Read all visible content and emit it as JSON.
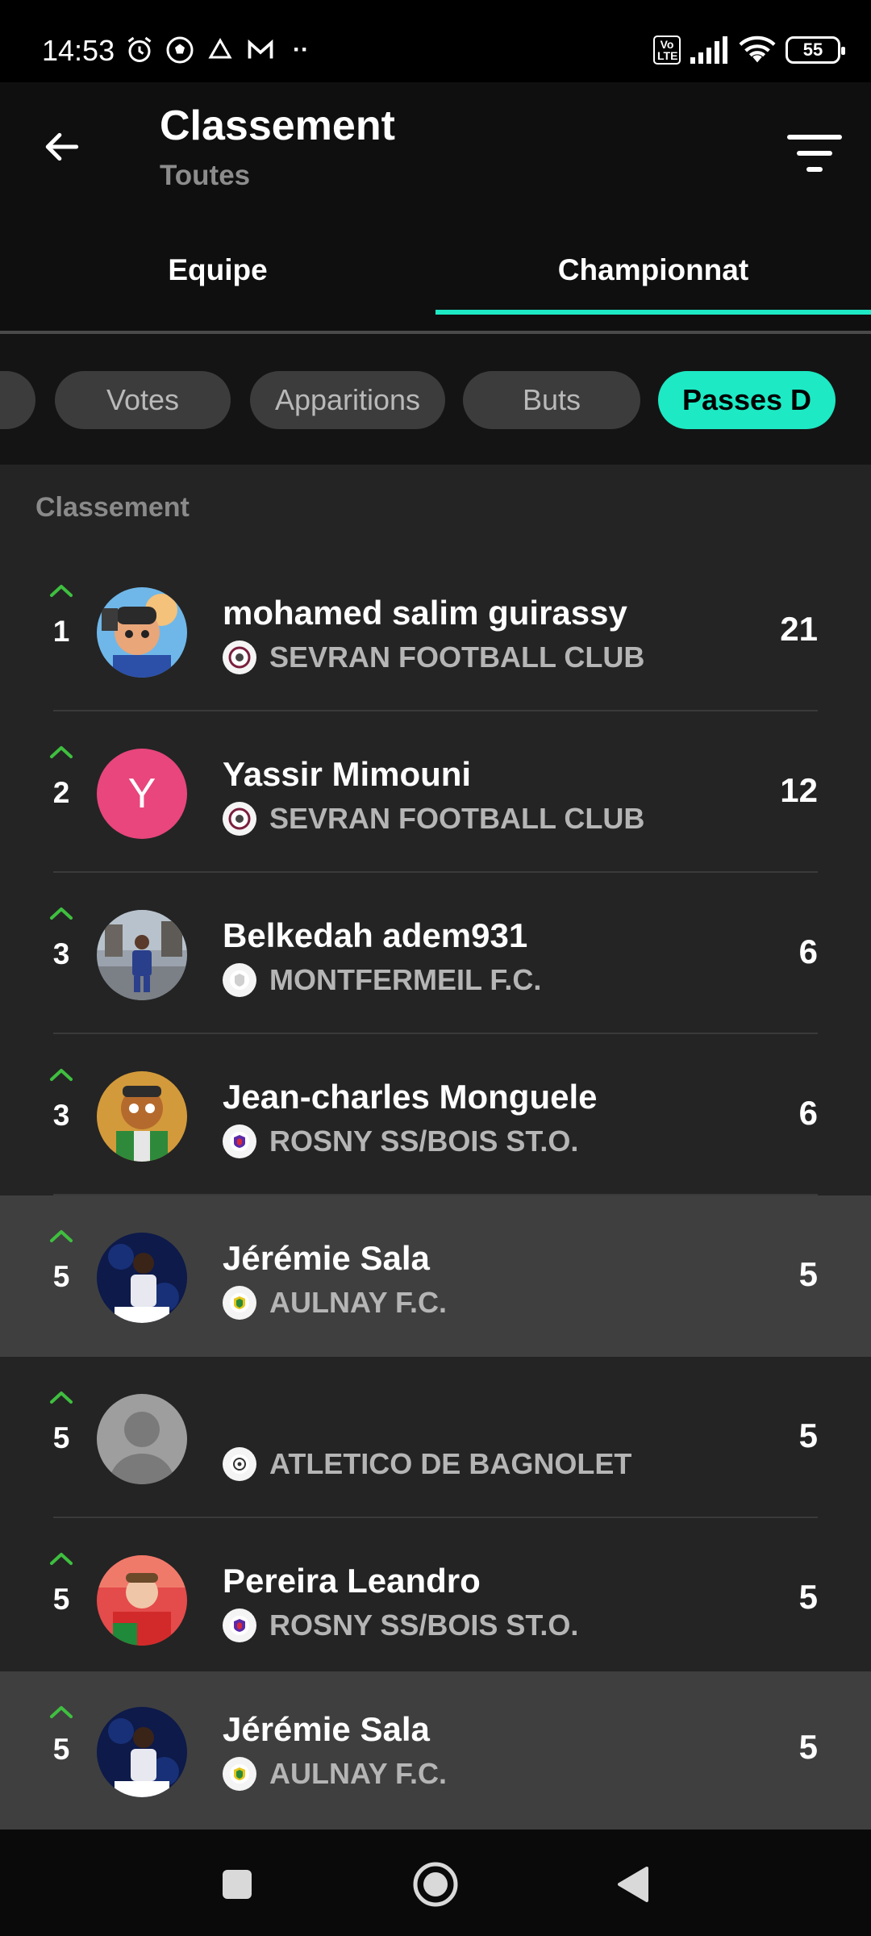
{
  "status_bar": {
    "time": "14:53",
    "battery": "55",
    "volte": "Vo LTE"
  },
  "header": {
    "title": "Classement",
    "subtitle": "Toutes"
  },
  "tabs": [
    {
      "label": "Equipe",
      "active": false
    },
    {
      "label": "Championnat",
      "active": true
    }
  ],
  "chips": [
    {
      "label": "Votes"
    },
    {
      "label": "Apparitions"
    },
    {
      "label": "Buts"
    },
    {
      "label": "Passes D",
      "active": true
    }
  ],
  "list_header": "Classement",
  "rows": [
    {
      "rank": "1",
      "name": "mohamed salim guirassy",
      "club": "SEVRAN FOOTBALL CLUB",
      "score": "21",
      "avatar": "cartoon-player"
    },
    {
      "rank": "2",
      "name": "Yassir Mimouni",
      "club": "SEVRAN FOOTBALL CLUB",
      "score": "12",
      "avatar": "initial",
      "initial": "Y"
    },
    {
      "rank": "3",
      "name": "Belkedah adem931",
      "club": "MONTFERMEIL F.C.",
      "score": "6",
      "avatar": "photo-street"
    },
    {
      "rank": "3",
      "name": "Jean-charles Monguele",
      "club": "ROSNY SS/BOIS ST.O.",
      "score": "6",
      "avatar": "cartoon-character"
    },
    {
      "rank": "5",
      "name": "Jérémie Sala",
      "club": "AULNAY F.C.",
      "score": "5",
      "avatar": "photo-player",
      "highlight": true
    },
    {
      "rank": "5",
      "name": "",
      "club": "ATLETICO DE BAGNOLET",
      "score": "5",
      "avatar": "default-person"
    },
    {
      "rank": "5",
      "name": "Pereira Leandro",
      "club": "ROSNY SS/BOIS ST.O.",
      "score": "5",
      "avatar": "photo-red-shirt"
    },
    {
      "rank": "5",
      "name": "Jérémie Sala",
      "club": "AULNAY F.C.",
      "score": "5",
      "avatar": "photo-player",
      "highlight": true
    }
  ],
  "colors": {
    "accent": "#1de9c4",
    "trend_up": "#3fbf3f",
    "initial_avatar": "#e8467c"
  }
}
